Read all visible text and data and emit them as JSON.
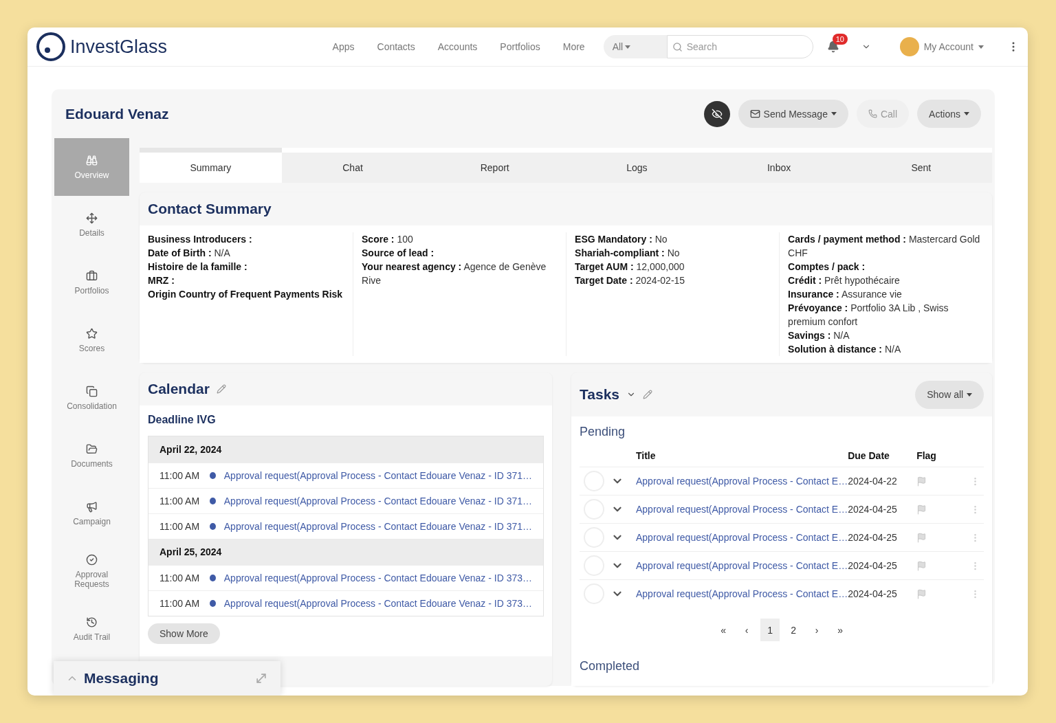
{
  "nav": {
    "logo": "InvestGlass",
    "links": [
      "Apps",
      "Contacts",
      "Accounts",
      "Portfolios",
      "More"
    ],
    "scope": "All",
    "search": {
      "placeholder": "Search"
    },
    "notifications": "10",
    "account": "My Account"
  },
  "contact": {
    "name": "Edouard Venaz",
    "send": "Send Message",
    "call": "Call",
    "actions": "Actions"
  },
  "sidebar": {
    "items": [
      {
        "label": "Overview",
        "selected": true
      },
      {
        "label": "Details",
        "selected": false
      },
      {
        "label": "Portfolios",
        "selected": false
      },
      {
        "label": "Scores",
        "selected": false
      },
      {
        "label": "Consolidation",
        "selected": false
      },
      {
        "label": "Documents",
        "selected": false
      },
      {
        "label": "Campaign",
        "selected": false
      },
      {
        "label": "Approval Requests",
        "selected": false
      },
      {
        "label": "Audit Trail",
        "selected": false
      }
    ]
  },
  "tabs": [
    {
      "label": "Summary",
      "selected": true
    },
    {
      "label": "Chat",
      "selected": false
    },
    {
      "label": "Report",
      "selected": false
    },
    {
      "label": "Logs",
      "selected": false
    },
    {
      "label": "Inbox",
      "selected": false
    },
    {
      "label": "Sent",
      "selected": false
    }
  ],
  "summary": {
    "title": "Contact Summary",
    "columns": [
      [
        "**Business Introducers :**",
        "**Date of Birth :** N/A",
        "**Histoire de la famille :**",
        "**MRZ :**",
        "**Origin Country of Frequent Payments Risk**"
      ],
      [
        "**Score :** 100",
        "**Source of lead :**",
        "**Your nearest agency :** Agence de Genève Rive"
      ],
      [
        "**ESG Mandatory :** No",
        "**Shariah-compliant :** No",
        "**Target AUM :** 12,000,000",
        "**Target Date :** 2024-02-15"
      ],
      [
        "**Cards / payment method :** Mastercard Gold CHF",
        "**Comptes / pack :**",
        "**Crédit :** Prêt hypothécaire",
        "**Insurance :** Assurance vie",
        "**Prévoyance :** Portfolio 3A Lib       , Swiss premium confort",
        "**Savings :** N/A",
        "**Solution à distance :** N/A"
      ]
    ]
  },
  "calendar": {
    "title": "Calendar",
    "section": "Deadline IVG",
    "groups": [
      {
        "date": "April 22, 2024",
        "events": [
          {
            "time": "11:00 AM",
            "title": "Approval request(Approval Process - Contact Edouare Venaz - ID 371…"
          },
          {
            "time": "11:00 AM",
            "title": "Approval request(Approval Process - Contact Edouare Venaz - ID 371…"
          },
          {
            "time": "11:00 AM",
            "title": "Approval request(Approval Process - Contact Edouare Venaz - ID 371…"
          }
        ]
      },
      {
        "date": "April 25, 2024",
        "events": [
          {
            "time": "11:00 AM",
            "title": "Approval request(Approval Process - Contact Edouare Venaz - ID 373…"
          },
          {
            "time": "11:00 AM",
            "title": "Approval request(Approval Process - Contact Edouare Venaz - ID 373…"
          }
        ]
      }
    ],
    "more": "Show More"
  },
  "tasks": {
    "title": "Tasks",
    "filter": "Show all",
    "pending": "Pending",
    "columns": [
      "Title",
      "Due Date",
      "Flag"
    ],
    "rows": [
      {
        "title": "Approval request(Approval Process - Contact E…",
        "due": "2024-04-22",
        "checked": false
      },
      {
        "title": "Approval request(Approval Process - Contact E…",
        "due": "2024-04-25",
        "checked": false
      },
      {
        "title": "Approval request(Approval Process - Contact E…",
        "due": "2024-04-25",
        "checked": false
      },
      {
        "title": "Approval request(Approval Process - Contact E…",
        "due": "2024-04-25",
        "checked": false
      },
      {
        "title": "Approval request(Approval Process - Contact E…",
        "due": "2024-04-25",
        "checked": false
      }
    ],
    "pagination": {
      "first": "«",
      "prev": "‹",
      "pages": [
        {
          "label": "1",
          "selected": true
        },
        {
          "label": "2",
          "selected": false
        }
      ],
      "next": "›",
      "last": "»"
    },
    "completed": "Completed"
  },
  "messaging": {
    "title": "Messaging"
  }
}
